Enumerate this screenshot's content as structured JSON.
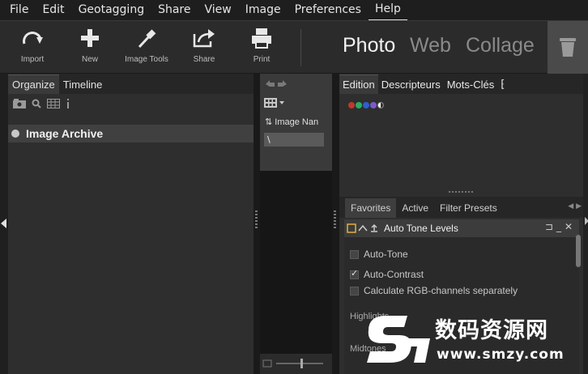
{
  "menu": {
    "items": [
      "File",
      "Edit",
      "Geotagging",
      "Share",
      "View",
      "Image",
      "Preferences",
      "Help"
    ],
    "active": "Help"
  },
  "toolbar": {
    "tools": [
      {
        "label": "Import",
        "icon": "import-icon"
      },
      {
        "label": "New",
        "icon": "plus-icon"
      },
      {
        "label": "Image Tools",
        "icon": "eyedropper-icon"
      },
      {
        "label": "Share",
        "icon": "share-icon"
      },
      {
        "label": "Print",
        "icon": "printer-icon"
      }
    ],
    "modes": [
      "Photo",
      "Web",
      "Collage"
    ],
    "active_mode": "Photo",
    "trash_icon": "trash-icon"
  },
  "left_panel": {
    "tabs": [
      "Organize",
      "Timeline"
    ],
    "selected_tab": "Organize",
    "archive_label": "Image Archive"
  },
  "middle_panel": {
    "column_header": "Image Nan",
    "field_value": "\\"
  },
  "right_panel": {
    "tabs": [
      "Edition",
      "Descripteurs",
      "Mots-Clés"
    ],
    "selected_tab": "Edition",
    "color_labels": [
      "#c0392b",
      "#27ae60",
      "#2c5fd0",
      "#7a5bc8"
    ],
    "fav_tabs": [
      "Favorites",
      "Active",
      "Filter Presets"
    ],
    "selected_fav_tab": "Favorites",
    "filter_title": "Auto Tone Levels",
    "options": [
      {
        "label": "Auto-Tone",
        "checked": false
      },
      {
        "label": "Auto-Contrast",
        "checked": true
      },
      {
        "label": "Calculate RGB-channels separately",
        "checked": false
      }
    ],
    "section_labels": [
      "Highlights",
      "Midtones"
    ]
  },
  "watermark": {
    "cn_text": "数码资源网",
    "url": "www.smzy.com"
  },
  "colors": {
    "bg": "#1a1a1a",
    "panel": "#2e2e2e",
    "selected_row": "#404040",
    "text": "#e0e0e0"
  }
}
